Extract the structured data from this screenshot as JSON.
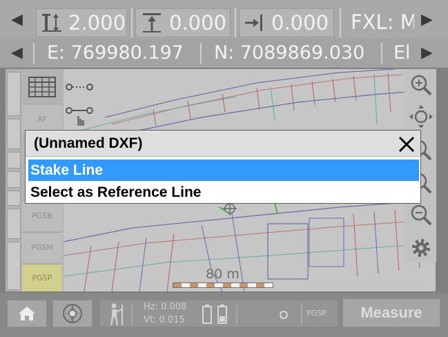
{
  "top_bar": {
    "height_value": "2.000",
    "offset_value": "0.000",
    "shift_value": "0.000",
    "fxl_label": "FXL: M"
  },
  "coord_bar": {
    "easting": "E: 769980.197",
    "northing": "N: 7089869.030",
    "elev_partial": "El"
  },
  "left_panel": {
    "af_label": "AF",
    "pgsb_label": "PGSB",
    "pgsm_label": "PGSM",
    "pgsp_label": "PGSP"
  },
  "map": {
    "scale_label": "80 m"
  },
  "dialog": {
    "title": "(Unnamed DXF)",
    "items": [
      "Stake Line",
      "Select as Reference Line"
    ]
  },
  "bottom_bar": {
    "hz": "Hz: 0.008",
    "vt": "Vt: 0.015",
    "pgsp": "PGSP",
    "measure_label": "Measure"
  },
  "colors": {
    "selection": "#3399ff",
    "pgsp_highlight": "#d2cf8c",
    "map_bg": "#c6c6c6"
  },
  "icons": [
    "chevron-left-icon",
    "chevron-right-icon",
    "height-icon",
    "offset-icon",
    "shift-icon",
    "grid-icon",
    "point-line-icon",
    "select-line-icon",
    "zoom-in-icon",
    "zoom-extents-icon",
    "zoom-out-icon",
    "gear-icon",
    "home-icon",
    "compass-icon",
    "surveyor-icon",
    "battery-icon",
    "close-icon"
  ]
}
